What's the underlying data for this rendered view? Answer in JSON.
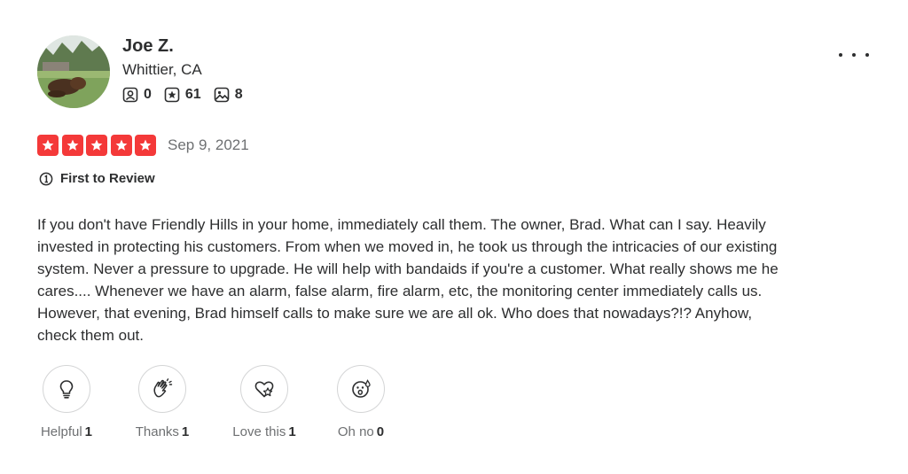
{
  "user": {
    "name": "Joe Z.",
    "location": "Whittier, CA",
    "stats": [
      {
        "icon": "friends-icon",
        "count": "0"
      },
      {
        "icon": "reviews-icon",
        "count": "61"
      },
      {
        "icon": "photos-icon",
        "count": "8"
      }
    ]
  },
  "review": {
    "rating": 5,
    "rating_color": "#f43939",
    "date": "Sep 9, 2021",
    "badge": "First to Review",
    "text": "If you don't have Friendly Hills in your home, immediately call them. The owner, Brad. What can I say. Heavily invested in protecting his customers. From when we moved in, he took us through the intricacies of our existing system. Never a pressure to upgrade. He will help with bandaids if you're a customer. What really shows me he cares.... Whenever we have an alarm, false alarm, fire alarm, etc, the monitoring center immediately calls us. However, that evening, Brad himself calls to make sure we are all ok. Who does that nowadays?!? Anyhow, check them out."
  },
  "reactions": [
    {
      "label": "Helpful",
      "count": "1",
      "icon": "lightbulb-icon"
    },
    {
      "label": "Thanks",
      "count": "1",
      "icon": "clapping-hands-icon"
    },
    {
      "label": "Love this",
      "count": "1",
      "icon": "heart-icon"
    },
    {
      "label": "Oh no",
      "count": "0",
      "icon": "surprised-face-icon"
    }
  ]
}
